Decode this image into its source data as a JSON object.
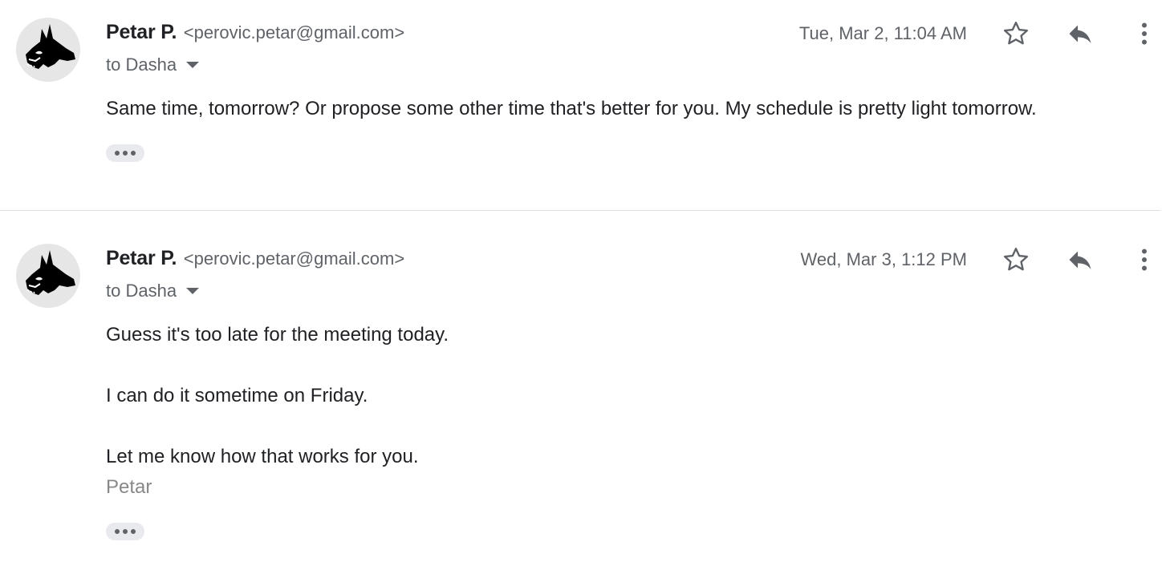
{
  "messages": [
    {
      "sender_name": "Petar P.",
      "sender_email": "<perovic.petar@gmail.com>",
      "to": "to Dasha",
      "date": "Tue, Mar 2, 11:04 AM",
      "body": "Same time, tomorrow? Or propose some other time that's better for you. My schedule is pretty light tomorrow."
    },
    {
      "sender_name": "Petar P.",
      "sender_email": "<perovic.petar@gmail.com>",
      "to": "to Dasha",
      "date": "Wed, Mar 3, 1:12 PM",
      "body_lines": [
        "Guess it's too late for the meeting today.",
        "I can do it sometime on Friday.",
        "Let me know how that works for you."
      ],
      "signature": "Petar"
    }
  ],
  "icons": {
    "avatar": "donkey-avatar-icon",
    "star": "star-outline-icon",
    "reply": "reply-icon",
    "more": "more-vert-icon",
    "caret": "caret-down-icon",
    "show_trimmed": "show-trimmed-content-icon"
  },
  "colors": {
    "text_primary": "#202124",
    "text_secondary": "#5f6368",
    "signature": "#888888",
    "divider": "#e0e0e0"
  }
}
